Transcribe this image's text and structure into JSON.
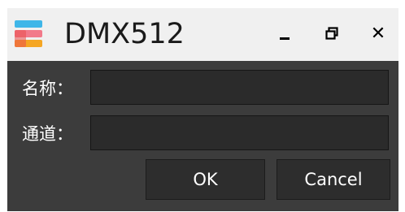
{
  "window": {
    "title": "DMX512",
    "icon": "app-logo-icon",
    "controls": {
      "minimize": "minimize-icon",
      "restore": "restore-icon",
      "close_glyph": "✕"
    }
  },
  "form": {
    "name_label": "名称：",
    "name_value": "",
    "channel_label": "通道：",
    "channel_value": ""
  },
  "buttons": {
    "ok_label": "OK",
    "cancel_label": "Cancel"
  },
  "colors": {
    "background": "#3c3c3c",
    "titlebar": "#f0f0f0",
    "field": "#2b2b2b",
    "button": "#2d2d2d",
    "text": "#ffffff"
  }
}
